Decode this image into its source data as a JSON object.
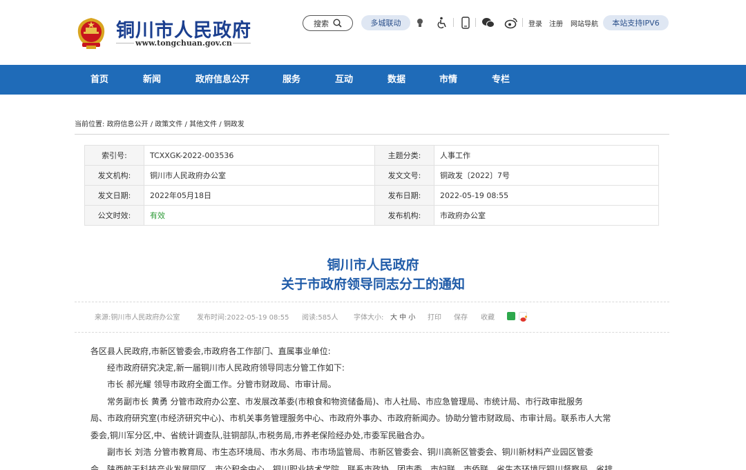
{
  "header": {
    "site_name": "铜川市人民政府",
    "site_url": "www.tongchuan.gov.cn",
    "search_label": "搜索",
    "multi_city_label": "多城联动",
    "login_label": "登录",
    "register_label": "注册",
    "sitemap_label": "网站导航",
    "ipv6_label": "本站支持IPV6"
  },
  "nav": {
    "items": [
      {
        "label": "首页"
      },
      {
        "label": "新闻"
      },
      {
        "label": "政府信息公开"
      },
      {
        "label": "服务"
      },
      {
        "label": "互动"
      },
      {
        "label": "数据"
      },
      {
        "label": "市情"
      },
      {
        "label": "专栏"
      }
    ]
  },
  "breadcrumb": {
    "prefix": "当前位置:",
    "items": [
      "政府信息公开",
      "政策文件",
      "其他文件",
      "铜政发"
    ]
  },
  "meta": {
    "rows": [
      {
        "k1": "索引号:",
        "v1": "TCXXGK-2022-003536",
        "k2": "主题分类:",
        "v2": "人事工作"
      },
      {
        "k1": "发文机构:",
        "v1": "铜川市人民政府办公室",
        "k2": "发文文号:",
        "v2": "铜政发〔2022〕7号"
      },
      {
        "k1": "发文日期:",
        "v1": "2022年05月18日",
        "k2": "发布日期:",
        "v2": "2022-05-19 08:55"
      },
      {
        "k1": "公文时效:",
        "v1": "有效",
        "k2": "发布机构:",
        "v2": "市政府办公室"
      }
    ]
  },
  "document": {
    "title_line1": "铜川市人民政府",
    "title_line2": "关于市政府领导同志分工的通知"
  },
  "info_bar": {
    "source": "来源:铜川市人民政府办公室",
    "publish_time": "发布时间:2022-05-19 08:55",
    "views": "阅读:585人",
    "font_size_label": "字体大小:",
    "font_sizes": "大 中 小",
    "print": "打印",
    "save": "保存",
    "favorite": "收藏"
  },
  "body": {
    "paragraphs": [
      "各区县人民政府,市新区管委会,市政府各工作部门、直属事业单位:",
      "　　经市政府研究决定,新一届铜川市人民政府领导同志分管工作如下:",
      "　　市长  郝光耀    领导市政府全面工作。分管市财政局、市审计局。",
      "　　常务副市长  黄勇      分管市政府办公室、市发展改革委(市粮食和物资储备局)、市人社局、市应急管理局、市统计局、市行政审批服务",
      "局、市政府研究室(市经济研究中心)、市机关事务管理服务中心、市政府外事办、市政府新闻办。协助分管市财政局、市审计局。联系市人大常",
      "委会,铜川军分区,中、省统计调查队,驻铜部队,市税务局,市养老保险经办处,市委军民融合办。",
      "　　副市长  刘浩      分管市教育局、市生态环境局、市水务局、市市场监管局、市新区管委会、铜川高新区管委会、铜川新材料产业园区管委",
      "会、陕西航天科技产业发展园区、市公积金中心、铜川职业技术学院。联系市政协、团市委、市妇联、市侨联、省生态环境厅铜川督察局、省排"
    ]
  },
  "colors": {
    "nav_bg": "#1f6bb8",
    "title": "#1f5ba8",
    "site_name": "#1b3f8f",
    "valid": "#2b9a35"
  },
  "icons": [
    "emblem-icon",
    "search-icon",
    "language-icon",
    "accessibility-icon",
    "mobile-icon",
    "wechat-icon",
    "weibo-icon",
    "share-wechat-icon",
    "share-weibo-icon"
  ]
}
